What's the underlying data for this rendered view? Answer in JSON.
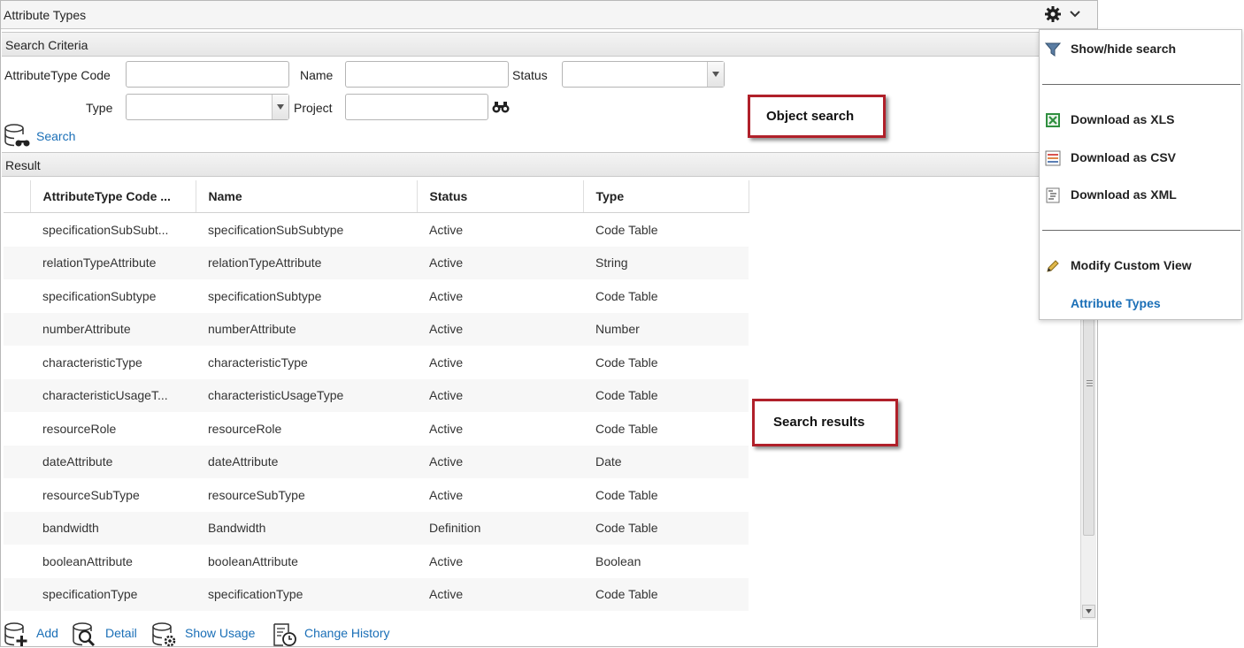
{
  "panel": {
    "title": "Attribute Types"
  },
  "search_criteria": {
    "header": "Search Criteria",
    "code_label": "AttributeType Code",
    "code_value": "",
    "name_label": "Name",
    "name_value": "",
    "status_label": "Status",
    "status_value": "",
    "type_label": "Type",
    "type_value": "",
    "project_label": "Project",
    "project_value": "",
    "search_link": "Search"
  },
  "result": {
    "header": "Result",
    "columns": [
      "AttributeType Code ...",
      "Name",
      "Status",
      "Type"
    ],
    "rows": [
      [
        "specificationSubSubt...",
        "specificationSubSubtype",
        "Active",
        "Code Table"
      ],
      [
        "relationTypeAttribute",
        "relationTypeAttribute",
        "Active",
        "String"
      ],
      [
        "specificationSubtype",
        "specificationSubtype",
        "Active",
        "Code Table"
      ],
      [
        "numberAttribute",
        "numberAttribute",
        "Active",
        "Number"
      ],
      [
        "characteristicType",
        "characteristicType",
        "Active",
        "Code Table"
      ],
      [
        "characteristicUsageT...",
        "characteristicUsageType",
        "Active",
        "Code Table"
      ],
      [
        "resourceRole",
        "resourceRole",
        "Active",
        "Code Table"
      ],
      [
        "dateAttribute",
        "dateAttribute",
        "Active",
        "Date"
      ],
      [
        "resourceSubType",
        "resourceSubType",
        "Active",
        "Code Table"
      ],
      [
        "bandwidth",
        "Bandwidth",
        "Definition",
        "Code Table"
      ],
      [
        "booleanAttribute",
        "booleanAttribute",
        "Active",
        "Boolean"
      ],
      [
        "specificationType",
        "specificationType",
        "Active",
        "Code Table"
      ]
    ]
  },
  "footer": {
    "add": "Add",
    "detail": "Detail",
    "show_usage": "Show Usage",
    "change_history": "Change History"
  },
  "menu": {
    "show_hide_search": "Show/hide search",
    "download_xls": "Download as XLS",
    "download_csv": "Download as CSV",
    "download_xml": "Download as XML",
    "modify_custom_view": "Modify Custom View",
    "attribute_types": "Attribute Types"
  },
  "callouts": {
    "object_search": "Object search",
    "search_results": "Search results"
  },
  "colors": {
    "link": "#1a6fb7",
    "callout_border": "#b0202a"
  }
}
